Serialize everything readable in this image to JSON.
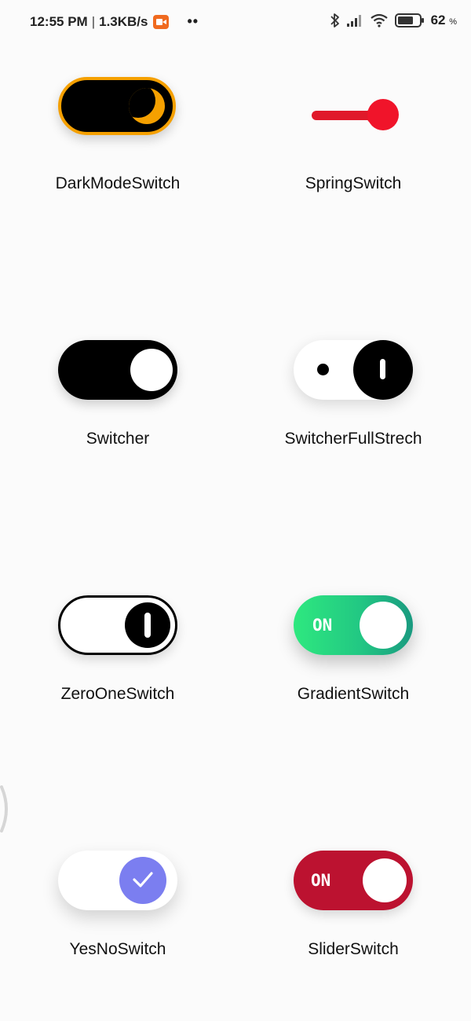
{
  "status_bar": {
    "time": "12:55 PM",
    "separator": "|",
    "network_speed": "1.3KB/s",
    "more_dots": "••",
    "battery_percent": "62",
    "battery_unit": "%",
    "icons": [
      "screen-record-icon",
      "bluetooth-icon",
      "cellular-signal-icon",
      "wifi-icon",
      "battery-icon"
    ]
  },
  "switches": [
    {
      "id": "dark_mode",
      "label": "DarkModeSwitch",
      "state": "on",
      "accent": "#f5a000"
    },
    {
      "id": "spring",
      "label": "SpringSwitch",
      "state": "on",
      "accent": "#e0192a"
    },
    {
      "id": "switcher",
      "label": "Switcher",
      "state": "on",
      "accent": "#000000"
    },
    {
      "id": "full_strech",
      "label": "SwitcherFullStrech",
      "state": "on",
      "accent": "#000000"
    },
    {
      "id": "zero_one",
      "label": "ZeroOneSwitch",
      "state": "on",
      "accent": "#000000"
    },
    {
      "id": "gradient",
      "label": "GradientSwitch",
      "state": "on",
      "on_text": "ON",
      "accent": "#22c883"
    },
    {
      "id": "yes_no",
      "label": "YesNoSwitch",
      "state": "on",
      "accent": "#7b7ef0"
    },
    {
      "id": "slider",
      "label": "SliderSwitch",
      "state": "on",
      "on_text": "ON",
      "accent": "#bc1230"
    }
  ]
}
